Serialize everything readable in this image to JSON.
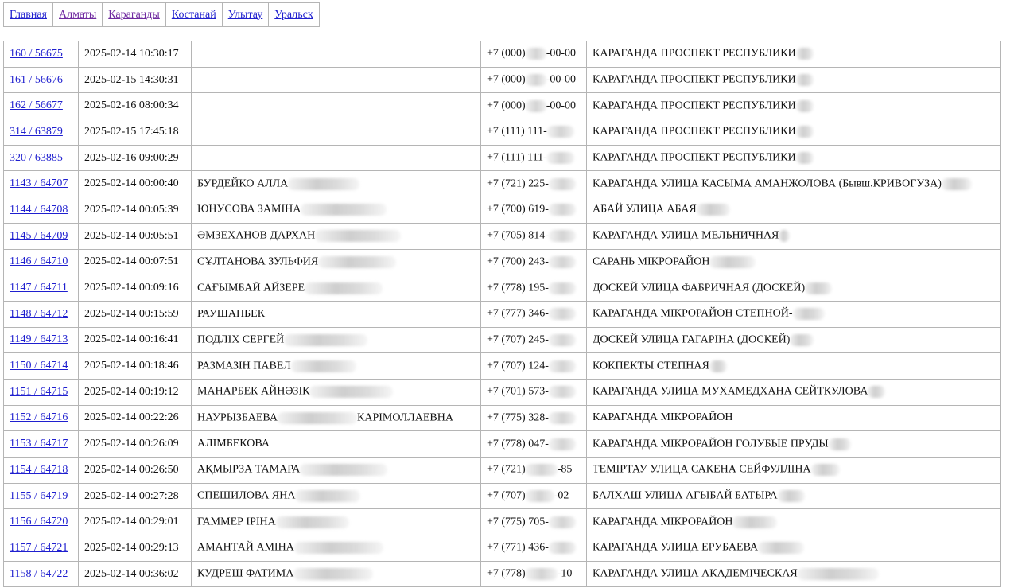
{
  "nav": [
    {
      "label": "Главная",
      "visited": false
    },
    {
      "label": "Алматы",
      "visited": true
    },
    {
      "label": "Караганды",
      "visited": true
    },
    {
      "label": "Костанай",
      "visited": false
    },
    {
      "label": "Улытау",
      "visited": false
    },
    {
      "label": "Уральск",
      "visited": false
    }
  ],
  "rows": [
    {
      "id": "160 / 56675",
      "date": "2025-02-14 10:30:17",
      "name": "",
      "phone": "+7 (000)",
      "phone_tail": "-00-00",
      "address": "КАРАГАНДА ПРОСПЕКТ РЕСПУБЛИКИ"
    },
    {
      "id": "161 / 56676",
      "date": "2025-02-15 14:30:31",
      "name": "",
      "phone": "+7 (000)",
      "phone_tail": "-00-00",
      "address": "КАРАГАНДА ПРОСПЕКТ РЕСПУБЛИКИ"
    },
    {
      "id": "162 / 56677",
      "date": "2025-02-16 08:00:34",
      "name": "",
      "phone": "+7 (000)",
      "phone_tail": "-00-00",
      "address": "КАРАГАНДА ПРОСПЕКТ РЕСПУБЛИКИ"
    },
    {
      "id": "314 / 63879",
      "date": "2025-02-15 17:45:18",
      "name": "",
      "phone": "+7 (111) 111-",
      "phone_tail": "",
      "address": "КАРАГАНДА ПРОСПЕКТ РЕСПУБЛИКИ"
    },
    {
      "id": "320 / 63885",
      "date": "2025-02-16 09:00:29",
      "name": "",
      "phone": "+7 (111) 111-",
      "phone_tail": "",
      "address": "КАРАГАНДА ПРОСПЕКТ РЕСПУБЛИКИ"
    },
    {
      "id": "1143 / 64707",
      "date": "2025-02-14 00:00:40",
      "name": "БУРДЕЙКО АЛЛА",
      "phone": "+7 (721) 225-",
      "phone_tail": "",
      "address": "КАРАГАНДА УЛИЦА КАСЫМА АМАНЖОЛОВА (Бывш.КРИВОГУЗА)"
    },
    {
      "id": "1144 / 64708",
      "date": "2025-02-14 00:05:39",
      "name": "ЮНУСОВА ЗАМІНА",
      "phone": "+7 (700) 619-",
      "phone_tail": "",
      "address": "АБАЙ УЛИЦА АБАЯ"
    },
    {
      "id": "1145 / 64709",
      "date": "2025-02-14 00:05:51",
      "name": "ӘМЗЕХАНОВ ДАРХАН",
      "phone": "+7 (705) 814-",
      "phone_tail": "",
      "address": "КАРАГАНДА УЛИЦА МЕЛЬНИЧНАЯ"
    },
    {
      "id": "1146 / 64710",
      "date": "2025-02-14 00:07:51",
      "name": "СҰЛТАНОВА ЗУЛЬФИЯ",
      "phone": "+7 (700) 243-",
      "phone_tail": "",
      "address": "САРАНЬ МІКРОРАЙОН"
    },
    {
      "id": "1147 / 64711",
      "date": "2025-02-14 00:09:16",
      "name": "САҒЫМБАЙ АЙЗЕРЕ",
      "phone": "+7 (778) 195-",
      "phone_tail": "",
      "address": "ДОСКЕЙ УЛИЦА ФАБРИЧНАЯ (ДОСКЕЙ)"
    },
    {
      "id": "1148 / 64712",
      "date": "2025-02-14 00:15:59",
      "name": "РАУШАНБЕК",
      "phone": "+7 (777) 346-",
      "phone_tail": "",
      "address": "КАРАГАНДА МІКРОРАЙОН СТЕПНОЙ-"
    },
    {
      "id": "1149 / 64713",
      "date": "2025-02-14 00:16:41",
      "name": "ПОДЛІХ СЕРГЕЙ",
      "phone": "+7 (707) 245-",
      "phone_tail": "",
      "address": "ДОСКЕЙ УЛИЦА ГАГАРІНА (ДОСКЕЙ)"
    },
    {
      "id": "1150 / 64714",
      "date": "2025-02-14 00:18:46",
      "name": "РАЗМАЗІН ПАВЕЛ",
      "phone": "+7 (707) 124-",
      "phone_tail": "",
      "address": "КОКПЕКТЫ СТЕПНАЯ"
    },
    {
      "id": "1151 / 64715",
      "date": "2025-02-14 00:19:12",
      "name": "МАНАРБЕК АЙНӘЗІК",
      "phone": "+7 (701) 573-",
      "phone_tail": "",
      "address": "КАРАГАНДА УЛИЦА МУХАМЕДХАНА СЕЙТКУЛОВА"
    },
    {
      "id": "1152 / 64716",
      "date": "2025-02-14 00:22:26",
      "name": "НАУРЫЗБАЕВА",
      "name_tail": "КАРІМОЛЛАЕВНА",
      "phone": "+7 (775) 328-",
      "phone_tail": "",
      "address": "КАРАГАНДА МІКРОРАЙОН"
    },
    {
      "id": "1153 / 64717",
      "date": "2025-02-14 00:26:09",
      "name": "АЛІМБЕКОВА",
      "phone": "+7 (778) 047-",
      "phone_tail": "",
      "address": "КАРАГАНДА МІКРОРАЙОН ГОЛУБЫЕ ПРУДЫ"
    },
    {
      "id": "1154 / 64718",
      "date": "2025-02-14 00:26:50",
      "name": "АҚМЫРЗА ТАМАРА",
      "phone": "+7 (721)",
      "phone_tail": "-85",
      "address": "ТЕМІРТАУ УЛИЦА САКЕНА СЕЙФУЛЛІНА"
    },
    {
      "id": "1155 / 64719",
      "date": "2025-02-14 00:27:28",
      "name": "СПЕШИЛОВА ЯНА",
      "phone": "+7 (707)",
      "phone_tail": "-02",
      "address": "БАЛХАШ УЛИЦА АГЫБАЙ БАТЫРА"
    },
    {
      "id": "1156 / 64720",
      "date": "2025-02-14 00:29:01",
      "name": "ГАММЕР ІРІНА",
      "phone": "+7 (775) 705-",
      "phone_tail": "",
      "address": "КАРАГАНДА МІКРОРАЙОН"
    },
    {
      "id": "1157 / 64721",
      "date": "2025-02-14 00:29:13",
      "name": "АМАНТАЙ АМІНА",
      "phone": "+7 (771) 436-",
      "phone_tail": "",
      "address": "КАРАГАНДА УЛИЦА ЕРУБАЕВА"
    },
    {
      "id": "1158 / 64722",
      "date": "2025-02-14 00:36:02",
      "name": "КУДРЕШ ФАТИМА",
      "phone": "+7 (778)",
      "phone_tail": "-10",
      "address": "КАРАГАНДА УЛИЦА АКАДЕМІЧЕСКАЯ"
    }
  ]
}
